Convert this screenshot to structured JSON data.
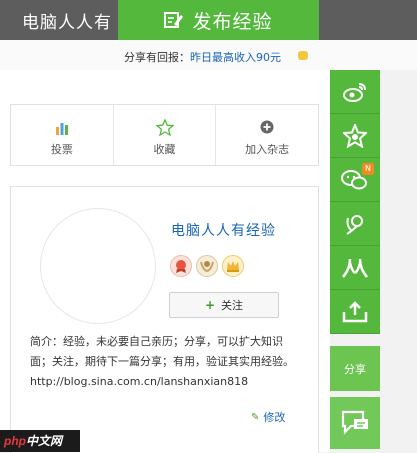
{
  "header": {
    "site_title": "电脑人人有",
    "publish_label": "发布经验"
  },
  "reward": {
    "prefix": "分享有回报：",
    "link_text": "昨日最高收入90元"
  },
  "actions": [
    {
      "label": "投票",
      "icon": "bar-chart-icon"
    },
    {
      "label": "收藏",
      "icon": "star-outline-icon"
    },
    {
      "label": "加入杂志",
      "icon": "plus-circle-icon"
    }
  ],
  "profile": {
    "name": "电脑人人有经验",
    "follow_label": "关注",
    "bio": "简介：经验，未必要自己亲历；分享，可以扩大知识面；关注，期待下一篇分享；有用，验证其实用经验。 http://blog.sina.com.cn/lanshanxian818",
    "edit_label": "修改",
    "badges": [
      {
        "icon": "red-medal-badge-icon",
        "color": "#e8553f"
      },
      {
        "icon": "laurel-badge-icon",
        "color": "#c9a463"
      },
      {
        "icon": "gold-crown-badge-icon",
        "color": "#f2b531"
      }
    ]
  },
  "side_toolbar": {
    "items": [
      {
        "name": "weibo-share",
        "icon": "weibo-icon"
      },
      {
        "name": "favorite",
        "icon": "star-badge-icon"
      },
      {
        "name": "wechat-share",
        "icon": "wechat-icon",
        "badge": "N"
      },
      {
        "name": "qq-share",
        "icon": "qq-weibo-icon"
      },
      {
        "name": "renren-share",
        "icon": "renren-icon"
      },
      {
        "name": "upload",
        "icon": "upload-icon"
      }
    ],
    "share_label": "分享",
    "feedback_icon": "chat-bubble-icon"
  },
  "watermark": {
    "text_prefix": "php",
    "text_suffix": "中文网"
  },
  "colors": {
    "accent_green": "#53b83c",
    "topbar_gray": "#5d5d5d",
    "link_blue": "#1a66b3"
  }
}
